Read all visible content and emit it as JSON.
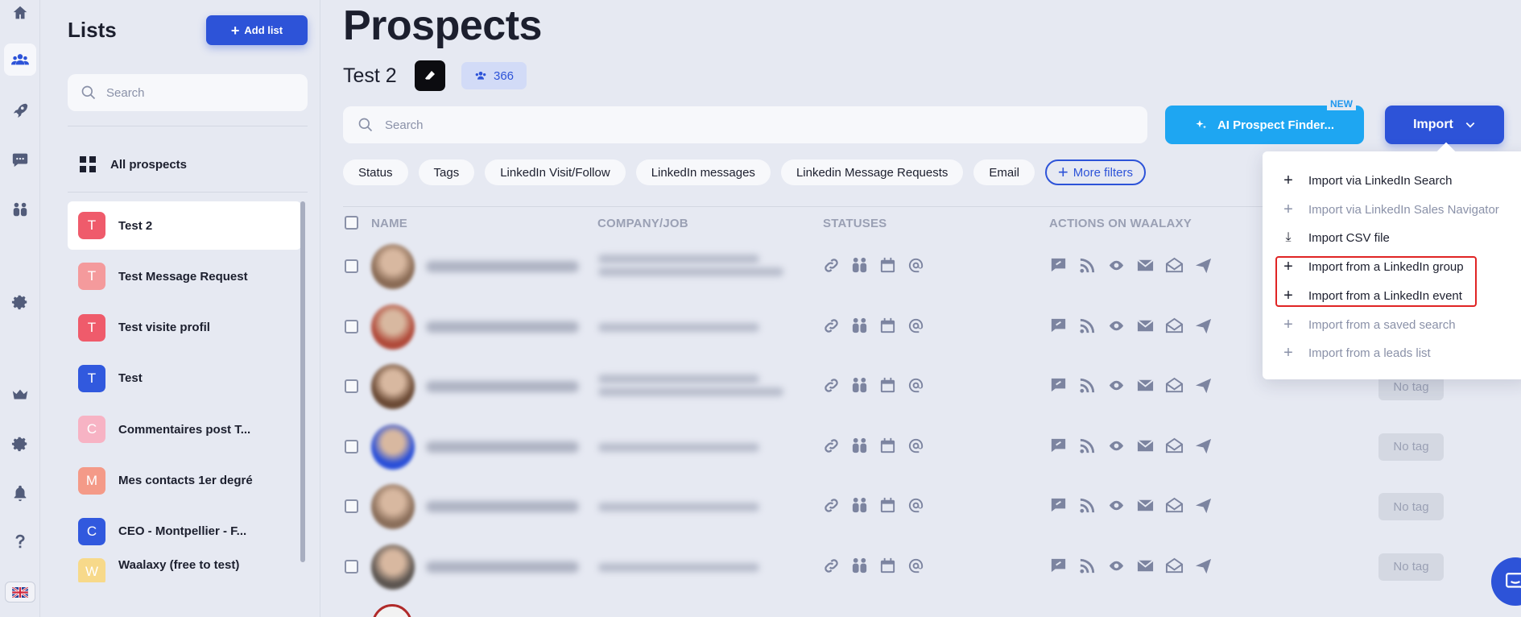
{
  "colors": {
    "accent": "#2d53d8",
    "ai_button": "#1ea6f2",
    "highlight": "#e02424"
  },
  "rail": {
    "icons": [
      "home-icon",
      "users-icon",
      "rocket-icon",
      "chat-icon",
      "team-icon",
      "settings-icon",
      "crown-icon",
      "gear-icon",
      "bell-icon",
      "help-icon",
      "uk-flag-icon"
    ]
  },
  "lists_panel": {
    "title": "Lists",
    "add_list_label": "Add list",
    "search_placeholder": "Search",
    "all_prospects_label": "All prospects",
    "items": [
      {
        "initial": "T",
        "label": "Test 2",
        "color": "#ef5b6b",
        "active": true
      },
      {
        "initial": "T",
        "label": "Test Message Request",
        "color": "#f49a9c",
        "active": false
      },
      {
        "initial": "T",
        "label": "Test visite profil",
        "color": "#ef5b6b",
        "active": false
      },
      {
        "initial": "T",
        "label": "Test",
        "color": "#3159de",
        "active": false
      },
      {
        "initial": "C",
        "label": "Commentaires post T...",
        "color": "#f7b3c4",
        "active": false
      },
      {
        "initial": "M",
        "label": "Mes contacts 1er degré",
        "color": "#f49a88",
        "active": false
      },
      {
        "initial": "C",
        "label": "CEO - Montpellier - F...",
        "color": "#3159de",
        "active": false
      },
      {
        "initial": "W",
        "label": "Waalaxy (free to test)",
        "color": "#f7d98a",
        "active": false
      }
    ]
  },
  "main": {
    "page_title": "Prospects",
    "list_name": "Test 2",
    "prospect_count": "366",
    "search_placeholder": "Search",
    "ai_button_label": "AI Prospect Finder...",
    "ai_new_tag": "NEW",
    "import_label": "Import",
    "filters": [
      "Status",
      "Tags",
      "LinkedIn Visit/Follow",
      "LinkedIn messages",
      "Linkedin Message Requests",
      "Email"
    ],
    "more_filters_label": "More filters",
    "columns": {
      "name": "NAME",
      "company": "COMPANY/JOB",
      "statuses": "STATUSES",
      "actions": "ACTIONS ON WAALAXY"
    },
    "no_tag_label": "No tag"
  },
  "import_menu": {
    "items": [
      {
        "glyph": "+",
        "label": "Import via LinkedIn Search",
        "disabled": false
      },
      {
        "glyph": "+",
        "label": "Import via LinkedIn Sales Navigator",
        "disabled": true
      },
      {
        "glyph": "⤓",
        "label": "Import CSV file",
        "disabled": false
      },
      {
        "glyph": "+",
        "label": "Import from a LinkedIn group",
        "disabled": false
      },
      {
        "glyph": "+",
        "label": "Import from a LinkedIn event",
        "disabled": false
      },
      {
        "glyph": "+",
        "label": "Import from a saved search",
        "disabled": true
      },
      {
        "glyph": "+",
        "label": "Import from a leads list",
        "disabled": true
      }
    ]
  }
}
